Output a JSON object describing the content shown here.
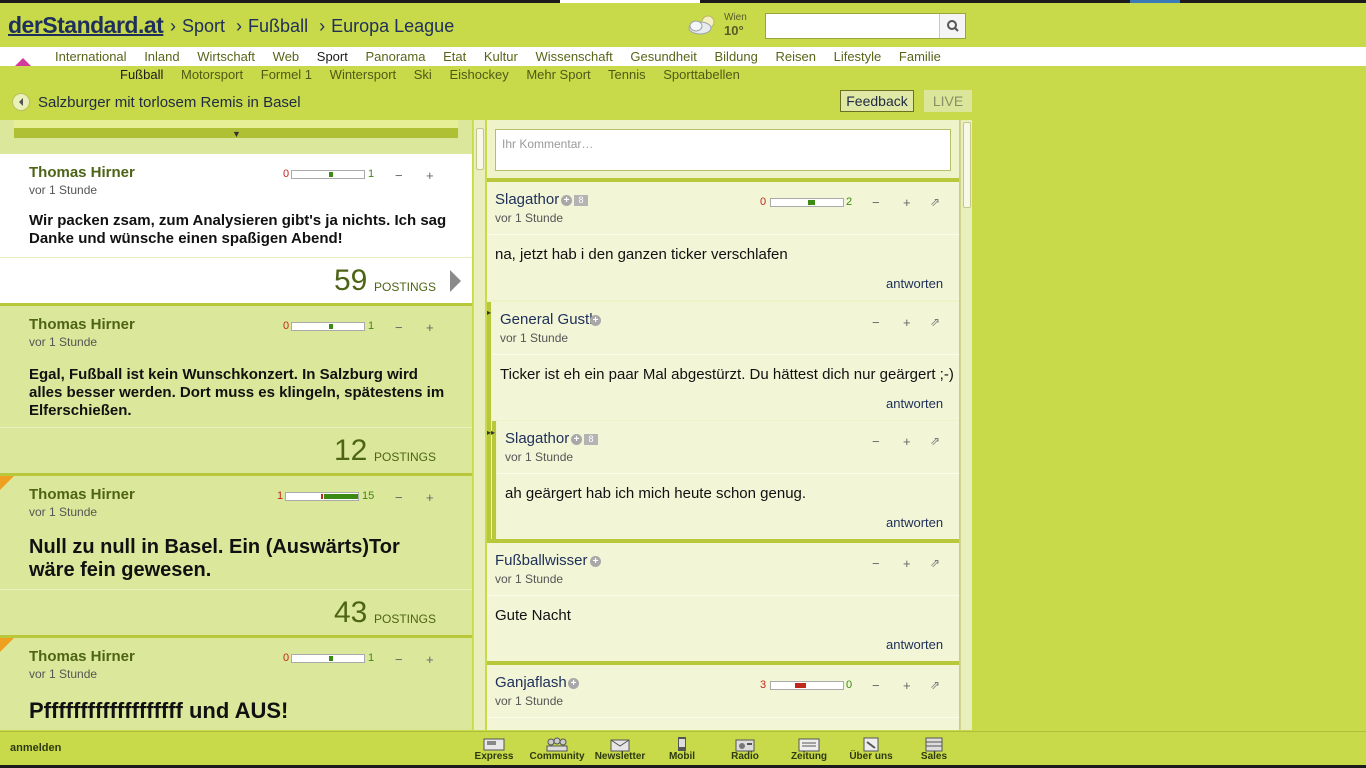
{
  "site": {
    "logo": "derStandard.at"
  },
  "breadcrumb": [
    "Sport",
    "Fußball",
    "Europa League"
  ],
  "weather": {
    "city": "Wien",
    "temp": "10°",
    "icon": "cloud-sun-icon"
  },
  "search": {
    "placeholder": "",
    "value": ""
  },
  "nav_main": [
    "International",
    "Inland",
    "Wirtschaft",
    "Web",
    "Sport",
    "Panorama",
    "Etat",
    "Kultur",
    "Wissenschaft",
    "Gesundheit",
    "Bildung",
    "Reisen",
    "Lifestyle",
    "Familie"
  ],
  "nav_main_active": "Sport",
  "nav_sub": [
    "Fußball",
    "Motorsport",
    "Formel 1",
    "Wintersport",
    "Ski",
    "Eishockey",
    "Mehr Sport",
    "Tennis",
    "Sporttabellen"
  ],
  "nav_sub_active": "Fußball",
  "titlebar": {
    "title": "Salzburger mit torlosem Remis in Basel",
    "feedback": "Feedback",
    "live": "LIVE"
  },
  "ticker": [
    {
      "author": "Thomas Hirner",
      "time": "vor 1 Stunde",
      "neg": "0",
      "pos": "1",
      "text": "Wir packen zsam, zum Analysieren gibt's ja nichts. Ich sag Danke und wünsche einen spaßigen Abend!",
      "postings": "59",
      "postings_label": "POSTINGS"
    },
    {
      "author": "Thomas Hirner",
      "time": "vor 1 Stunde",
      "neg": "0",
      "pos": "1",
      "text": "Egal, Fußball ist kein Wunschkonzert. In Salzburg wird alles besser werden. Dort muss es klingeln, spätestens im Elferschießen.",
      "postings": "12",
      "postings_label": "POSTINGS"
    },
    {
      "author": "Thomas Hirner",
      "time": "vor 1 Stunde",
      "neg": "1",
      "pos": "15",
      "text": "Null zu null in Basel. Ein (Auswärts)Tor wäre fein gewesen.",
      "postings": "43",
      "postings_label": "POSTINGS"
    },
    {
      "author": "Thomas Hirner",
      "time": "vor 1 Stunde",
      "neg": "0",
      "pos": "1",
      "text": "Pfffffffffffffffffff und AUS!"
    }
  ],
  "forum": {
    "comment_placeholder": "Ihr Kommentar…",
    "reply_label": "antworten",
    "posts": [
      {
        "user": "Slagathor",
        "level": "8",
        "time": "vor 1 Stunde",
        "neg": "0",
        "pos": "2",
        "body": "na, jetzt hab i den ganzen ticker verschlafen"
      },
      {
        "user": "General Gustl",
        "time": "vor 1 Stunde",
        "body": "Ticker ist eh ein paar Mal abgestürzt. Du hättest dich nur geärgert ;-)"
      },
      {
        "user": "Slagathor",
        "level": "8",
        "time": "vor 1 Stunde",
        "body": "ah geärgert hab ich mich heute schon genug."
      },
      {
        "user": "Fußballwisser",
        "time": "vor 1 Stunde",
        "body": "Gute Nacht"
      },
      {
        "user": "Ganjaflash",
        "time": "vor 1 Stunde",
        "neg": "3",
        "pos": "0"
      }
    ]
  },
  "footer": {
    "login": "anmelden",
    "items": [
      "Express",
      "Community",
      "Newsletter",
      "Mobil",
      "Radio",
      "Zeitung",
      "Über uns",
      "Sales"
    ]
  },
  "colors": {
    "brand_green": "#c8d94a",
    "logo_blue": "#1f2f5c",
    "negative": "#c0281c",
    "positive": "#3c8a14"
  }
}
